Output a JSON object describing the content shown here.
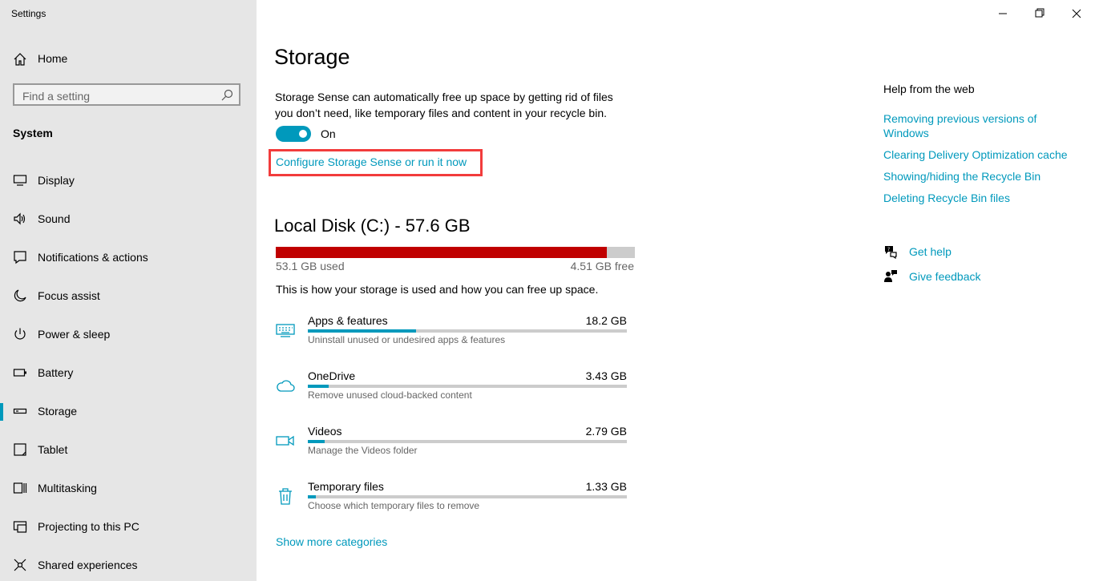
{
  "window": {
    "title": "Settings"
  },
  "sidebar": {
    "home_label": "Home",
    "search_placeholder": "Find a setting",
    "section_title": "System",
    "items": [
      {
        "label": "Display",
        "icon": "monitor-icon"
      },
      {
        "label": "Sound",
        "icon": "speaker-icon"
      },
      {
        "label": "Notifications & actions",
        "icon": "notification-icon"
      },
      {
        "label": "Focus assist",
        "icon": "moon-icon"
      },
      {
        "label": "Power & sleep",
        "icon": "power-icon"
      },
      {
        "label": "Battery",
        "icon": "battery-icon"
      },
      {
        "label": "Storage",
        "icon": "storage-icon",
        "active": true
      },
      {
        "label": "Tablet",
        "icon": "tablet-icon"
      },
      {
        "label": "Multitasking",
        "icon": "multitasking-icon"
      },
      {
        "label": "Projecting to this PC",
        "icon": "projecting-icon"
      },
      {
        "label": "Shared experiences",
        "icon": "shared-icon"
      }
    ]
  },
  "main": {
    "title": "Storage",
    "description": "Storage Sense can automatically free up space by getting rid of files you don’t need, like temporary files and content in your recycle bin.",
    "toggle": {
      "state": "On",
      "on": true
    },
    "configure_link": "Configure Storage Sense or run it now",
    "disk": {
      "title": "Local Disk (C:) - 57.6 GB",
      "used_label": "53.1 GB used",
      "free_label": "4.51 GB free",
      "used_fraction": 0.922
    },
    "usage_note": "This is how your storage is used and how you can free up space.",
    "categories": [
      {
        "name": "Apps & features",
        "size": "18.2 GB",
        "description": "Uninstall unused or undesired apps & features",
        "fraction": 0.34,
        "icon": "keyboard-icon"
      },
      {
        "name": "OneDrive",
        "size": "3.43 GB",
        "description": "Remove unused cloud-backed content",
        "fraction": 0.065,
        "icon": "cloud-icon"
      },
      {
        "name": "Videos",
        "size": "2.79 GB",
        "description": "Manage the Videos folder",
        "fraction": 0.053,
        "icon": "video-camera-icon"
      },
      {
        "name": "Temporary files",
        "size": "1.33 GB",
        "description": "Choose which temporary files to remove",
        "fraction": 0.025,
        "icon": "trash-icon"
      }
    ],
    "show_more": "Show more categories"
  },
  "help": {
    "title": "Help from the web",
    "links": [
      "Removing previous versions of Windows",
      "Clearing Delivery Optimization cache",
      "Showing/hiding the Recycle Bin",
      "Deleting Recycle Bin files"
    ],
    "get_help": "Get help",
    "give_feedback": "Give feedback"
  },
  "colors": {
    "accent": "#0099bc",
    "disk_used": "#c00000",
    "highlight_box": "#f23c3c",
    "sidebar_bg": "#e6e6e6"
  }
}
